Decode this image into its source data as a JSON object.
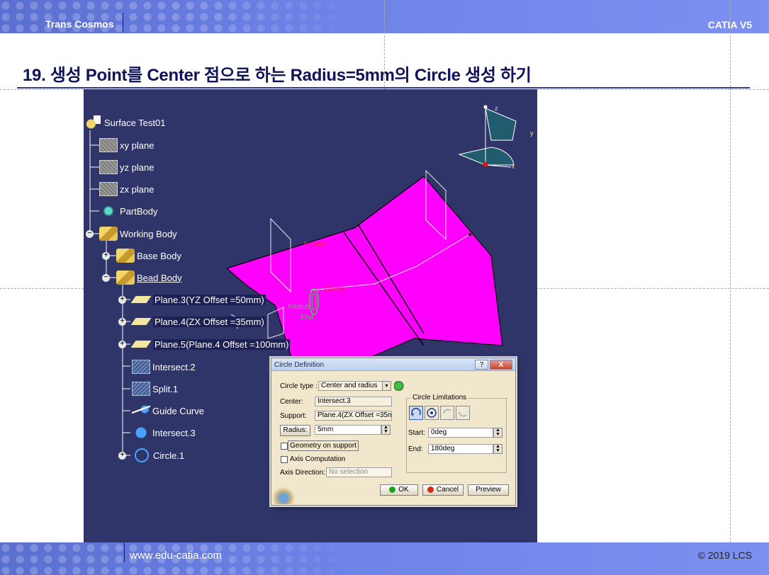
{
  "header": {
    "brand_left": "Trans Cosmos",
    "brand_right": "CATIA V5"
  },
  "title": "19. 생성 Point를 Center 점으로 하는 Radius=5mm의 Circle 생성 하기",
  "footer": {
    "website": "www.edu-catia.com",
    "copyright": "© 2019 LCS"
  },
  "tree": {
    "root": "Surface Test01",
    "items": [
      {
        "label": "xy plane",
        "icon": "plane-icon"
      },
      {
        "label": "yz plane",
        "icon": "plane-icon"
      },
      {
        "label": "zx plane",
        "icon": "plane-icon"
      },
      {
        "label": "PartBody",
        "icon": "gear-icon"
      },
      {
        "label": "Working Body",
        "icon": "body-icon",
        "toggle": "minus"
      },
      {
        "label": "Base Body",
        "icon": "body-icon",
        "toggle": "plus"
      },
      {
        "label": "Bead Body",
        "icon": "body-icon",
        "toggle": "minus"
      },
      {
        "label": "Plane.3(YZ Offset =50mm)",
        "icon": "plane-feature-icon",
        "toggle": "plus"
      },
      {
        "label": "Plane.4(ZX Offset =35mm)",
        "icon": "plane-feature-icon",
        "toggle": "plus"
      },
      {
        "label": "Plane.5(Plane.4 Offset =100mm)",
        "icon": "plane-feature-icon",
        "toggle": "plus"
      },
      {
        "label": "Intersect.2",
        "icon": "intersect-icon"
      },
      {
        "label": "Split.1",
        "icon": "split-icon"
      },
      {
        "label": "Guide Curve",
        "icon": "guide-curve-icon"
      },
      {
        "label": "Intersect.3",
        "icon": "intersect-icon"
      },
      {
        "label": "Circle.1",
        "icon": "circle-icon",
        "toggle": "plus"
      }
    ]
  },
  "scene": {
    "surface_color": "#ff00ff",
    "background_color": "#2f3568",
    "axis_labels": {
      "z": "z",
      "y": "y",
      "x": "x"
    },
    "labels": {
      "support": "Support",
      "center": "Center",
      "radius": "Radius",
      "end": "End"
    }
  },
  "dialog": {
    "title": "Circle Definition",
    "help_label": "?",
    "close_label": "X",
    "circle_type_label": "Circle type :",
    "circle_type_value": "Center and radius",
    "center_label": "Center:",
    "center_value": "Intersect.3",
    "support_label": "Support:",
    "support_value": "Plane.4(ZX Offset =35m",
    "radius_button": "Radius:",
    "radius_value": "5mm",
    "geometry_on_support": "Geometry on support",
    "axis_computation": "Axis Computation",
    "axis_direction_label": "Axis Direction:",
    "axis_direction_placeholder": "No selection",
    "limitations_title": "Circle Limitations",
    "start_label": "Start:",
    "start_value": "0deg",
    "end_label": "End:",
    "end_value": "180deg",
    "ok_label": "OK",
    "cancel_label": "Cancel",
    "preview_label": "Preview",
    "ok_color": "#1aa31a",
    "cancel_color": "#d42a1a"
  }
}
